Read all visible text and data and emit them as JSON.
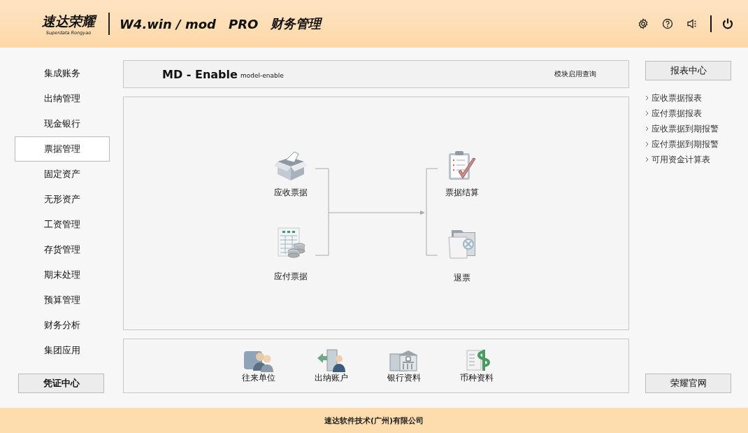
{
  "header": {
    "logo": "速达荣耀",
    "logo_sub": "Superdata Rongyao",
    "product": "W4.win / mod",
    "edition": "PRO",
    "module": "财务管理"
  },
  "sidebar": {
    "items": [
      {
        "label": "集成账务",
        "selected": false
      },
      {
        "label": "出纳管理",
        "selected": false
      },
      {
        "label": "现金银行",
        "selected": false
      },
      {
        "label": "票据管理",
        "selected": true
      },
      {
        "label": "固定资产",
        "selected": false
      },
      {
        "label": "无形资产",
        "selected": false
      },
      {
        "label": "工资管理",
        "selected": false
      },
      {
        "label": "存货管理",
        "selected": false
      },
      {
        "label": "期末处理",
        "selected": false
      },
      {
        "label": "预算管理",
        "selected": false
      },
      {
        "label": "财务分析",
        "selected": false
      },
      {
        "label": "集团应用",
        "selected": false
      }
    ],
    "button": "凭证中心"
  },
  "module_bar": {
    "title": "MD - Enable",
    "subtitle": "model-enable",
    "link": "模块启用查询"
  },
  "flow": {
    "nodes": [
      {
        "label": "应收票据",
        "kind": "box"
      },
      {
        "label": "应付票据",
        "kind": "sheet"
      },
      {
        "label": "票据结算",
        "kind": "clipboard"
      },
      {
        "label": "退票",
        "kind": "folder"
      }
    ]
  },
  "shortcuts": [
    {
      "label": "往来单位",
      "kind": "people"
    },
    {
      "label": "出纳账户",
      "kind": "door"
    },
    {
      "label": "银行资料",
      "kind": "bank"
    },
    {
      "label": "币种资料",
      "kind": "dollar"
    }
  ],
  "right_panel": {
    "button": "报表中心",
    "links": [
      "应收票据报表",
      "应付票据报表",
      "应收票据到期报警",
      "应付票据到期报警",
      "可用资金计算表"
    ],
    "bottom_button": "荣耀官网"
  },
  "footer": "速达软件技术(广州)有限公司"
}
